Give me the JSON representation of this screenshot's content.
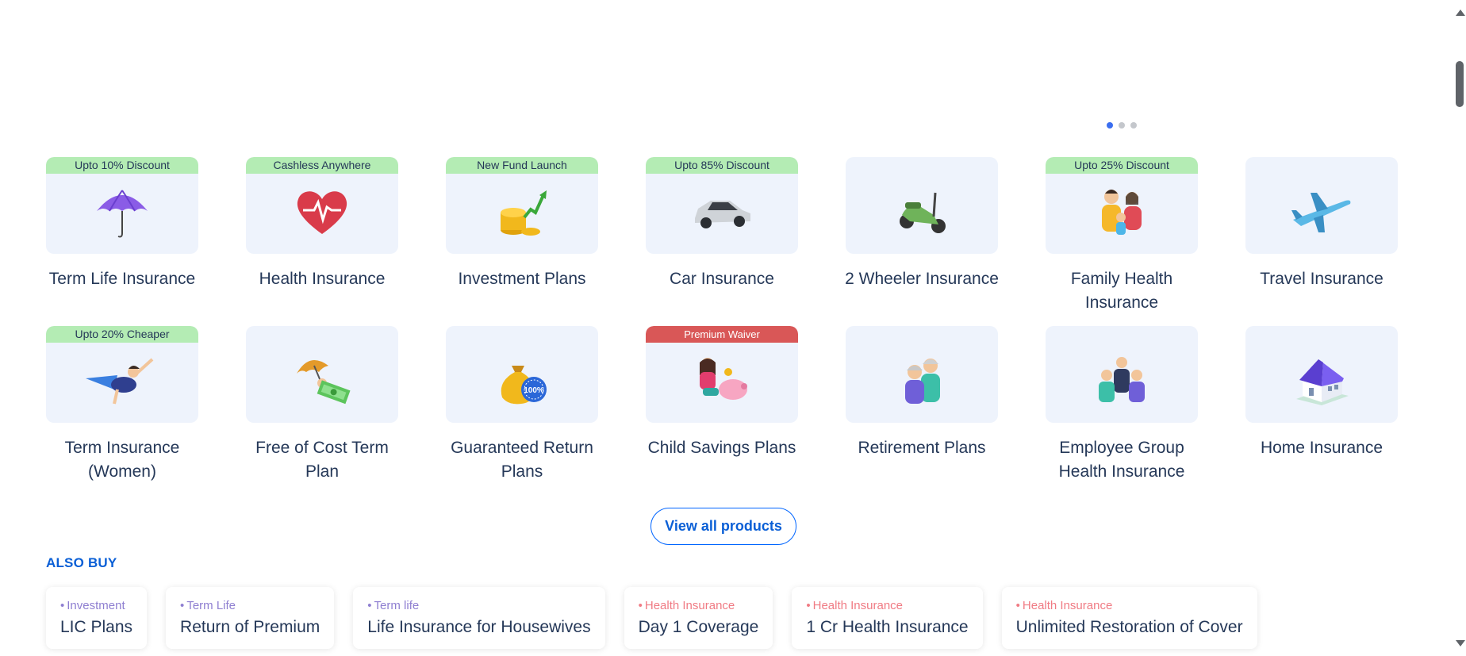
{
  "carousel": {
    "dots": 3,
    "active_index": 0
  },
  "products": [
    {
      "name": "Term Life Insurance",
      "badge": "Upto 10% Discount",
      "badge_style": "green",
      "icon": "umbrella-icon"
    },
    {
      "name": "Health Insurance",
      "badge": "Cashless Anywhere",
      "badge_style": "green",
      "icon": "heart-pulse-icon"
    },
    {
      "name": "Investment Plans",
      "badge": "New Fund Launch",
      "badge_style": "green",
      "icon": "coins-growth-icon"
    },
    {
      "name": "Car Insurance",
      "badge": "Upto 85% Discount",
      "badge_style": "green",
      "icon": "car-icon"
    },
    {
      "name": "2 Wheeler Insurance",
      "badge": "",
      "badge_style": "",
      "icon": "scooter-icon"
    },
    {
      "name": "Family Health Insurance",
      "badge": "Upto 25% Discount",
      "badge_style": "green",
      "icon": "family-icon"
    },
    {
      "name": "Travel Insurance",
      "badge": "",
      "badge_style": "",
      "icon": "airplane-icon"
    },
    {
      "name": "Term Insurance (Women)",
      "badge": "Upto 20% Cheaper",
      "badge_style": "green",
      "icon": "flying-woman-icon"
    },
    {
      "name": "Free of Cost Term Plan",
      "badge": "",
      "badge_style": "",
      "icon": "umbrella-cash-icon"
    },
    {
      "name": "Guaranteed Return Plans",
      "badge": "",
      "badge_style": "",
      "icon": "money-bag-icon",
      "icon_text": "100%"
    },
    {
      "name": "Child Savings Plans",
      "badge": "Premium Waiver",
      "badge_style": "red",
      "icon": "child-piggy-bank-icon"
    },
    {
      "name": "Retirement Plans",
      "badge": "",
      "badge_style": "",
      "icon": "elderly-couple-icon"
    },
    {
      "name": "Employee Group Health Insurance",
      "badge": "",
      "badge_style": "",
      "icon": "employee-group-icon"
    },
    {
      "name": "Home Insurance",
      "badge": "",
      "badge_style": "",
      "icon": "house-icon"
    }
  ],
  "view_all_label": "View all products",
  "also_buy": {
    "heading": "ALSO BUY",
    "items": [
      {
        "category": "Investment",
        "title": "LIC Plans",
        "color": "#8f7fd1"
      },
      {
        "category": "Term Life",
        "title": "Return of Premium",
        "color": "#8f7fd1"
      },
      {
        "category": "Term life",
        "title": "Life Insurance for Housewives",
        "color": "#8f7fd1"
      },
      {
        "category": "Health Insurance",
        "title": "Day 1 Coverage",
        "color": "#f07b84"
      },
      {
        "category": "Health Insurance",
        "title": "1 Cr Health Insurance",
        "color": "#f07b84"
      },
      {
        "category": "Health Insurance",
        "title": "Unlimited Restoration of Cover",
        "color": "#f07b84"
      }
    ]
  },
  "colors": {
    "accent": "#0a5fd6",
    "card_bg": "#eef3fc",
    "badge_green": "#b4ecb4",
    "badge_red": "#d95757"
  }
}
